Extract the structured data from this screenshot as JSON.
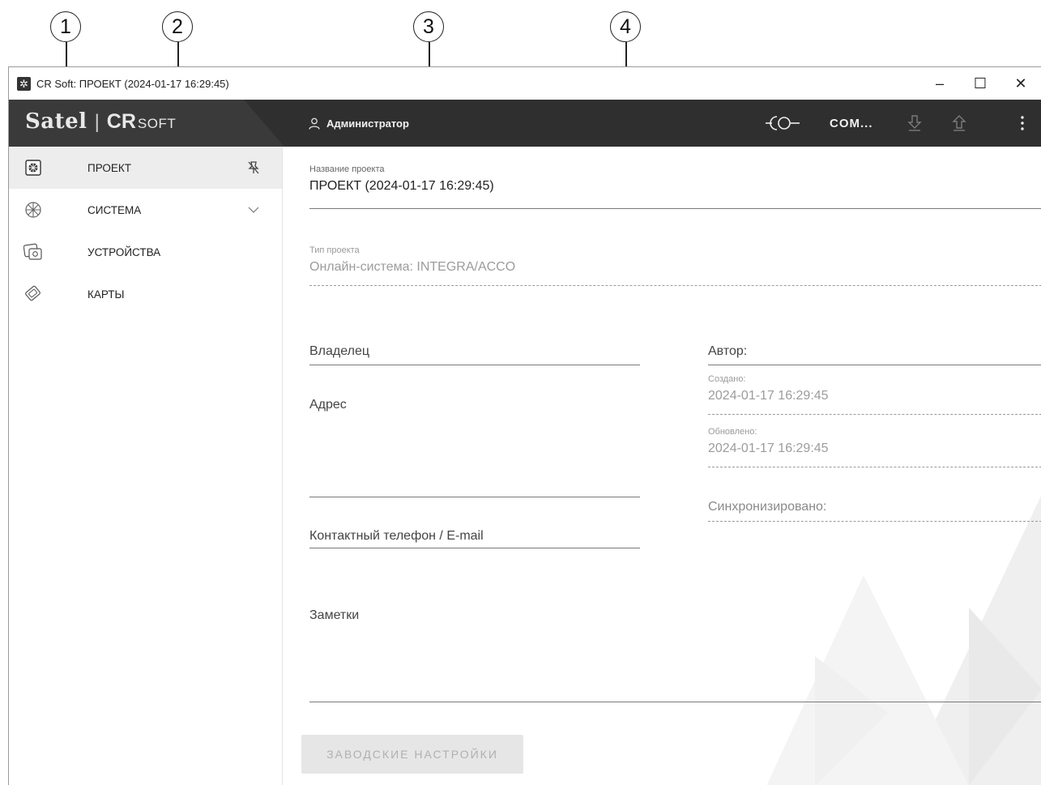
{
  "callouts": [
    "1",
    "2",
    "3",
    "4"
  ],
  "window": {
    "title": "CR Soft: ПРОЕКТ (2024-01-17 16:29:45)",
    "controls": {
      "minimize": "–",
      "maximize": "☐",
      "close": "✕"
    }
  },
  "header": {
    "logo_brand": "Satel",
    "logo_sep": "|",
    "logo_cr": "CR",
    "logo_soft": "SOFT",
    "user_name": "Администратор",
    "connection_port": "COM...",
    "icons": [
      "user-icon",
      "connection-icon",
      "download-icon",
      "upload-icon",
      "more-vertical-icon"
    ]
  },
  "sidebar": {
    "items": [
      {
        "label": "ПРОЕКТ",
        "icon": "project-icon",
        "trail": "unpin-icon",
        "active": true
      },
      {
        "label": "СИСТЕМА",
        "icon": "system-icon",
        "trail": "chevron-down-icon",
        "active": false
      },
      {
        "label": "УСТРОЙСТВА",
        "icon": "devices-icon",
        "trail": "",
        "active": false
      },
      {
        "label": "КАРТЫ",
        "icon": "cards-icon",
        "trail": "",
        "active": false
      }
    ]
  },
  "project": {
    "name_label": "Название проекта",
    "name_value": "ПРОЕКТ (2024-01-17 16:29:45)",
    "type_label": "Тип проекта",
    "type_value": "Онлайн-система: INTEGRA/ACCO",
    "owner_label": "Владелец",
    "address_label": "Адрес",
    "contact_label": "Контактный телефон / E-mail",
    "notes_label": "Заметки",
    "author_label": "Автор:",
    "created_label": "Создано:",
    "created_value": "2024-01-17 16:29:45",
    "updated_label": "Обновлено:",
    "updated_value": "2024-01-17 16:29:45",
    "synced_label": "Синхронизировано:",
    "reset_button": "ЗАВОДСКИЕ НАСТРОЙКИ"
  },
  "colors": {
    "header_bg": "#2f2f2f",
    "logo_bg": "#3a3a3a",
    "active_item_bg": "#ededed"
  }
}
